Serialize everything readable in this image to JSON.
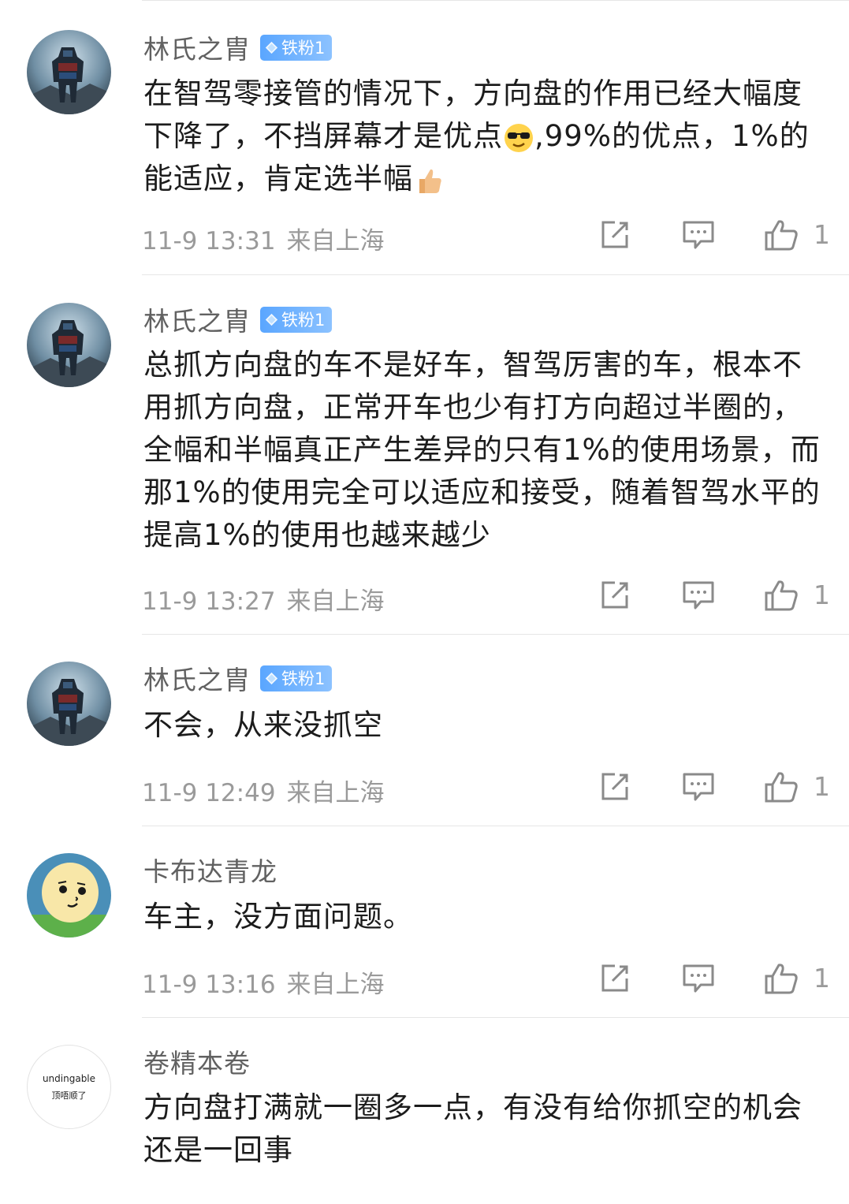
{
  "comments": [
    {
      "user": "林氏之胄",
      "badge": "铁粉1",
      "avatar": "transformer-avatar",
      "text_parts": [
        "在智驾零接管的情况下，方向盘的作用已经大幅度下降了，不挡屏幕才是优点",
        ",99%的优点，1%的能适应，肯定选半幅"
      ],
      "emojis": [
        "sunglasses-emoji",
        "thumbs-up-emoji"
      ],
      "time": "11-9 13:31",
      "location": "来自上海",
      "likes": "1"
    },
    {
      "user": "林氏之胄",
      "badge": "铁粉1",
      "avatar": "transformer-avatar",
      "text": "总抓方向盘的车不是好车，智驾厉害的车，根本不用抓方向盘，正常开车也少有打方向超过半圈的，全幅和半幅真正产生差异的只有1%的使用场景，而那1%的使用完全可以适应和接受，随着智驾水平的提高1%的使用也越来越少",
      "time": "11-9 13:27",
      "location": "来自上海",
      "likes": "1"
    },
    {
      "user": "林氏之胄",
      "badge": "铁粉1",
      "avatar": "transformer-avatar",
      "text": "不会，从来没抓空",
      "time": "11-9 12:49",
      "location": "来自上海",
      "likes": "1"
    },
    {
      "user": "卡布达青龙",
      "avatar": "cartoon-face-avatar",
      "text": "车主，没方面问题。",
      "time": "11-9 13:16",
      "location": "来自上海",
      "likes": "1"
    },
    {
      "user": "卷精本卷",
      "avatar": "text-avatar",
      "avatar_text_1": "undingable",
      "avatar_text_2": "顶唔顺了",
      "text": "方向盘打满就一圈多一点，有没有给你抓空的机会还是一回事"
    }
  ],
  "colors": {
    "badge": "#5aa6ff",
    "meta": "#9a9a9a",
    "name": "#616161"
  }
}
